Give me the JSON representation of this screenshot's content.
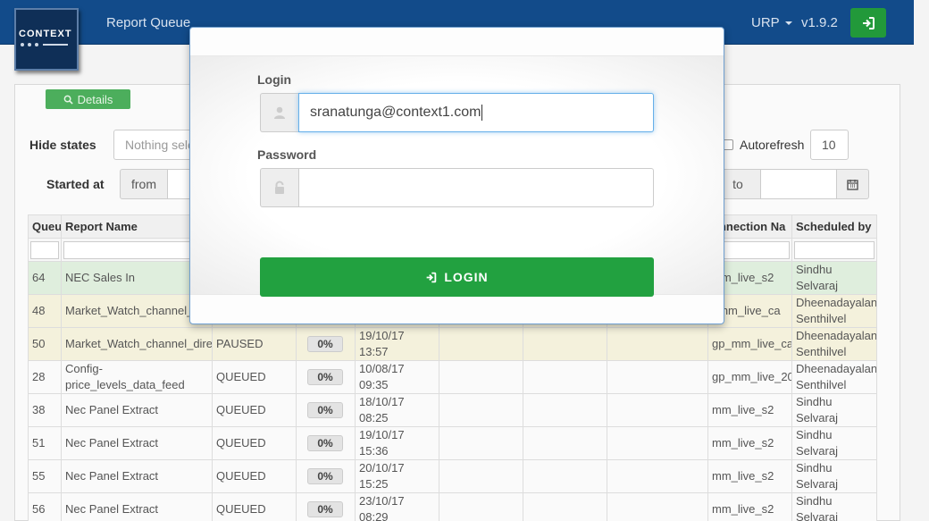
{
  "nav": {
    "logo_text": "CONTEXT",
    "title": "Report Queue",
    "user_menu": "URP",
    "version": "v1.9.2",
    "login_icon": "sign-in-icon"
  },
  "toolbar": {
    "details_label": "Details",
    "hide_states_label": "Hide states",
    "hide_states_placeholder": "Nothing sele",
    "autorefresh_label": "Autorefresh",
    "autorefresh_value": "10",
    "started_at_label": "Started at",
    "from_label": "from",
    "to_label": "to"
  },
  "table": {
    "headers": [
      "Queu",
      "Report Name",
      "",
      "",
      "",
      "",
      "",
      "",
      "onnection Na",
      "Scheduled by"
    ],
    "rows": [
      {
        "id": "64",
        "name": "NEC Sales In",
        "state": "",
        "pct": "",
        "date": "",
        "conn": "mm_live_s2",
        "by": "Sindhu Selvaraj",
        "style": "green"
      },
      {
        "id": "48",
        "name": "Market_Watch_channel_",
        "state": "",
        "pct": "",
        "date": "",
        "conn": "_mm_live_ca",
        "by": "Dheenadayalan Senthilvel",
        "style": "yellow"
      },
      {
        "id": "50",
        "name": "Market_Watch_channel_dire",
        "state": "PAUSED",
        "pct": "0%",
        "date": "19/10/17 13:57",
        "conn": "gp_mm_live_ca",
        "by": "Dheenadayalan Senthilvel",
        "style": "yellow"
      },
      {
        "id": "28",
        "name": "Config-price_levels_data_feed",
        "state": "QUEUED",
        "pct": "0%",
        "date": "10/08/17 09:35",
        "conn": "gp_mm_live_20",
        "by": "Dheenadayalan Senthilvel",
        "style": "plain"
      },
      {
        "id": "38",
        "name": "Nec Panel Extract",
        "state": "QUEUED",
        "pct": "0%",
        "date": "18/10/17 08:25",
        "conn": "mm_live_s2",
        "by": "Sindhu Selvaraj",
        "style": "plain"
      },
      {
        "id": "51",
        "name": "Nec Panel Extract",
        "state": "QUEUED",
        "pct": "0%",
        "date": "19/10/17 15:36",
        "conn": "mm_live_s2",
        "by": "Sindhu Selvaraj",
        "style": "plain"
      },
      {
        "id": "55",
        "name": "Nec Panel Extract",
        "state": "QUEUED",
        "pct": "0%",
        "date": "20/10/17 15:25",
        "conn": "mm_live_s2",
        "by": "Sindhu Selvaraj",
        "style": "plain"
      },
      {
        "id": "56",
        "name": "Nec Panel Extract",
        "state": "QUEUED",
        "pct": "0%",
        "date": "23/10/17 08:29",
        "conn": "mm_live_s2",
        "by": "Sindhu Selvaraj",
        "style": "plain"
      }
    ]
  },
  "modal": {
    "login_label": "Login",
    "login_value": "sranatunga@context1.com",
    "password_label": "Password",
    "password_value": "",
    "submit_label": "LOGIN"
  },
  "colors": {
    "navbar": "#124b8a",
    "success": "#22a140",
    "focus": "#66afe9"
  }
}
